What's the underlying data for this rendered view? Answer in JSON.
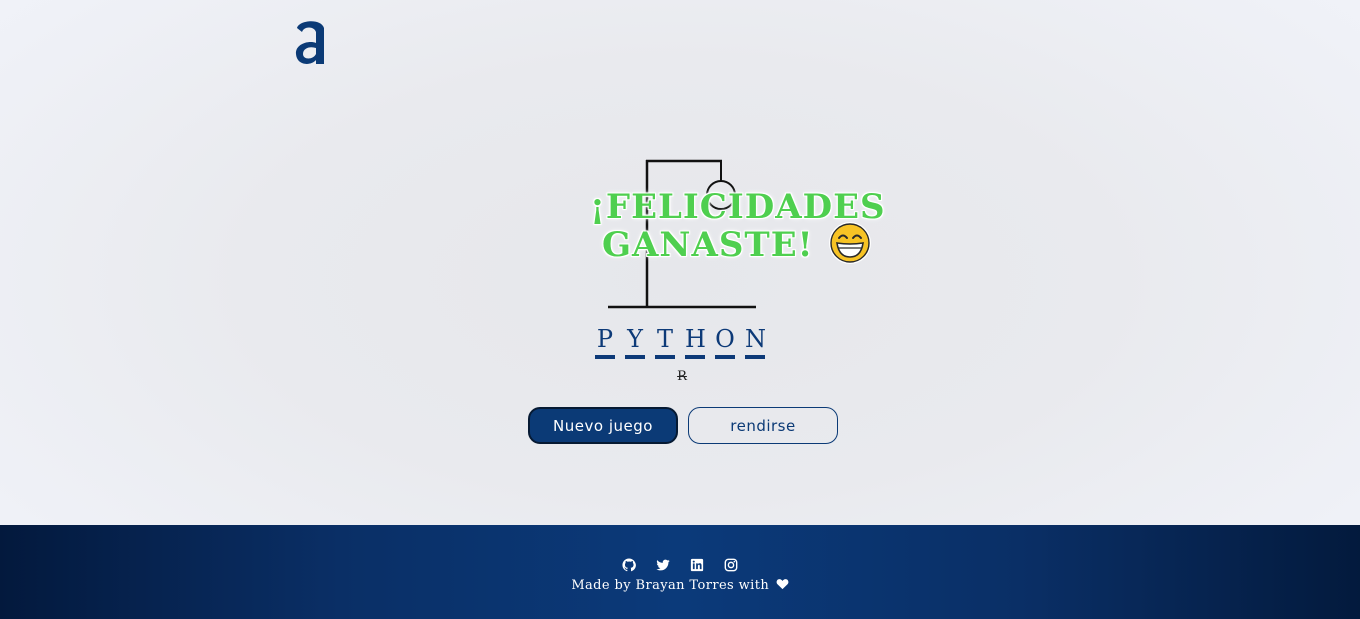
{
  "header": {
    "logo_icon": "a-logo-icon",
    "brand_color": "#0b3a76"
  },
  "game": {
    "result_message_line1": "¡FELICIDADES",
    "result_message_line2": "GANASTE!",
    "result_emoji_icon": "grinning-face-icon",
    "message_color": "#4fcf4f",
    "word_letters": [
      "P",
      "Y",
      "T",
      "H",
      "O",
      "N"
    ],
    "wrong_letters": "R",
    "actions": {
      "new_game_label": "Nuevo juego",
      "give_up_label": "rendirse"
    }
  },
  "footer": {
    "social_icons": [
      "github-icon",
      "twitter-icon",
      "linkedin-icon",
      "instagram-icon"
    ],
    "credit_text": "Made by Brayan Torres with",
    "heart_icon": "heart-icon"
  }
}
